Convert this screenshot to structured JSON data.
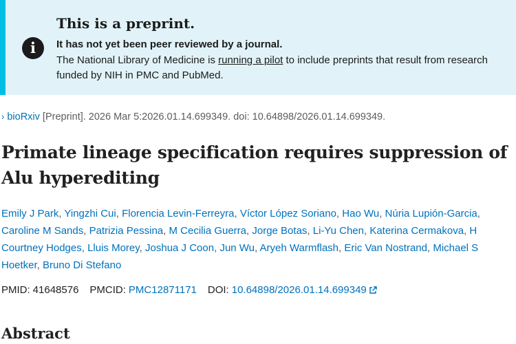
{
  "banner": {
    "title": "This is a preprint.",
    "strong": "It has not yet been peer reviewed by a journal.",
    "text_before": "The National Library of Medicine is ",
    "link": "running a pilot",
    "text_after": " to include preprints that result from research funded by NIH in PMC and PubMed.",
    "icon": "info-icon"
  },
  "citation": {
    "chevron": "›",
    "journal": "bioRxiv",
    "rest": " [Preprint]. 2026 Mar 5:2026.01.14.699349. doi: 10.64898/2026.01.14.699349."
  },
  "title": "Primate lineage specification requires suppression of Alu hyperediting",
  "authors": [
    "Emily J Park",
    "Yingzhi Cui",
    "Florencia Levin-Ferreyra",
    "Víctor López Soriano",
    "Hao Wu",
    "Núria Lupión-Garcia",
    "Caroline M Sands",
    "Patrizia Pessina",
    "M Cecilia Guerra",
    "Jorge Botas",
    "Li-Yu Chen",
    "Katerina Cermakova",
    "H Courtney Hodges",
    "Lluis Morey",
    "Joshua J Coon",
    "Jun Wu",
    "Aryeh Warmflash",
    "Eric Van Nostrand",
    "Michael S Hoetker",
    "Bruno Di Stefano"
  ],
  "ids": {
    "pmid_label": "PMID:",
    "pmid": "41648576",
    "pmcid_label": "PMCID:",
    "pmcid": "PMC12871171",
    "doi_label": "DOI:",
    "doi": "10.64898/2026.01.14.699349",
    "doi_icon": "external-link-icon"
  },
  "abstract_heading": "Abstract"
}
